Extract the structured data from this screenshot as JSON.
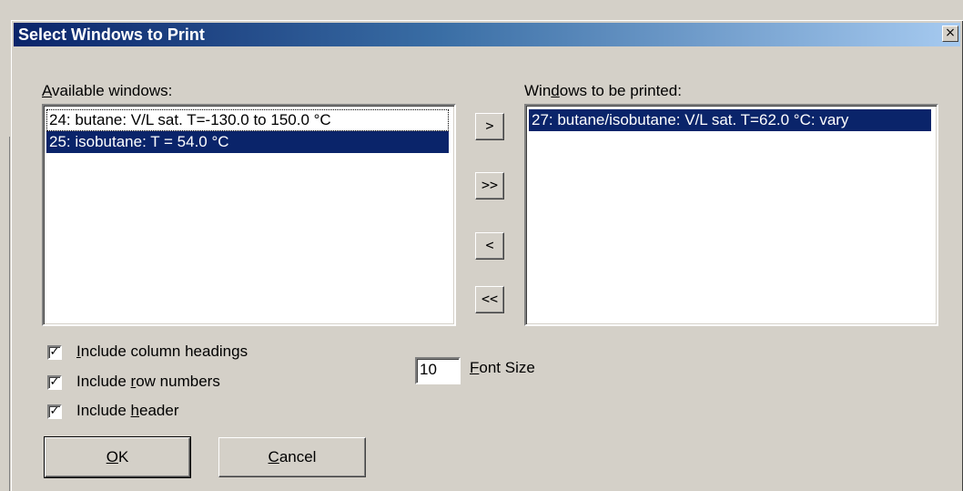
{
  "dialog": {
    "title": "Select Windows to Print",
    "close_glyph": "×"
  },
  "available": {
    "label_pre": "",
    "label_ul": "A",
    "label_post": "vailable windows:",
    "items": [
      "24: butane: V/L sat. T=-130.0 to 150.0 °C",
      "25: isobutane: T = 54.0 °C"
    ]
  },
  "printed": {
    "label_pre": "Win",
    "label_ul": "d",
    "label_post": "ows to be printed:",
    "items": [
      "27: butane/isobutane: V/L sat. T=62.0 °C: vary"
    ]
  },
  "transfer": {
    "add_one": ">",
    "add_all": ">>",
    "remove_one": "<",
    "remove_all": "<<"
  },
  "options": {
    "column_headings": {
      "checked": true,
      "mark": "✓",
      "pre": "",
      "ul": "I",
      "post": "nclude column headings"
    },
    "row_numbers": {
      "checked": true,
      "mark": "✓",
      "pre": "Include ",
      "ul": "r",
      "post": "ow numbers"
    },
    "header": {
      "checked": true,
      "mark": "✓",
      "pre": "Include ",
      "ul": "h",
      "post": "eader"
    }
  },
  "font_size": {
    "value": "10",
    "label_ul": "F",
    "label_post": "ont Size"
  },
  "buttons": {
    "ok_ul": "O",
    "ok_post": "K",
    "cancel_ul": "C",
    "cancel_post": "ancel"
  }
}
